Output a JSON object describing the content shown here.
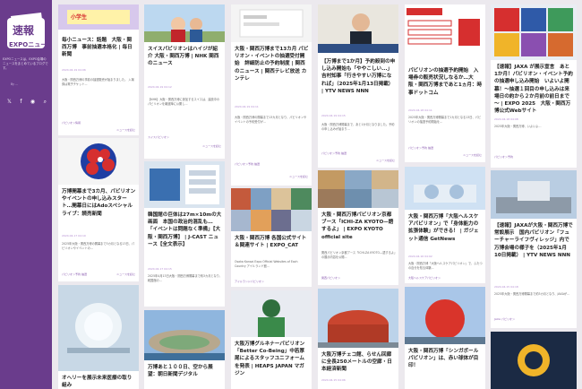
{
  "sidebar": {
    "logo_text": "EXPOニュース",
    "logo_top": "速報",
    "description": "EXPOニュースは、EXPO会場のニュースをまとめているブログです。",
    "link": "By ...",
    "icons": [
      "x-icon",
      "facebook-icon",
      "rss-icon",
      "search-icon"
    ]
  },
  "cards": [
    {
      "title": "毎小ニュース：話題　大阪・関西万博　事前抽選本格化 | 毎日新聞",
      "date": "2024.04.19 04:06",
      "excerpt": "大阪・関西万博の事前の抽選販売が始まりました。 入場券は電子チケット...",
      "tag": "パビリオン情報",
      "cm": "ニュースを読む"
    },
    {
      "title": "スイスパビリオンはハイジが紹介 大阪・関西万博 | NHK 関西のニュース",
      "date": "2024.04.19 04:12",
      "excerpt": "【NHK】大阪・関西万博に参加するスイスは、建設中のパビリオンを報道陣に公開し...",
      "tag": "スイスパビリオン",
      "cm": "ニュースを読む"
    },
    {
      "title": "大阪・関西万博まで13カ月 パビリオン・イベントの抽選受付開始　詳細防止の予約制度 | 関西のニュース | 関西テレビ放送 カンテレ",
      "date": "2024.04.19 04:11",
      "excerpt": "大阪・関西万博の開幕まで13カ月となり、パビリオンやイベントの予約受付が...",
      "tag": "パビリオン予約 抽選",
      "cm": "ニュースを読む"
    },
    {
      "title": "【万博まで1か月】予約殺到の申し込み開始も「ややこしい...」吉村知事「行きやすい万博になれば」（2025年1月13日掲載） | YTV NEWS NNN",
      "date": "2024.04.19 04:15",
      "excerpt": "大阪・関西万博開幕まで、あと1か月となりました。予約の申し込みが始まり...",
      "tag": "パビリオン予約 抽選",
      "cm": "ニュースを読む"
    },
    {
      "title": "パビリオンの抽選予約開始　入場券の販売状況しなるか…大阪・関西万博まであと1ヵ月：時事ドットコム",
      "date": "2024.04.18 04:11",
      "excerpt": "2025年大阪・関西万博開幕まで1カ月となる13日、パビリオンの抽選予約開始を...",
      "tag": "パビリオン予約 抽選",
      "cm": "ニュースを読む"
    },
    {
      "title": "【速報】JAXA が展示宣言　あと1か月！パビリオン・イベント予約の抽選申し込み開始　いよいよ開幕！～抽選１回目の申し込みは来場日の約から２か月前の前日まで～ | EXPO 2025　大阪・関西万博公式Webサイト",
      "date": "2024.04.18 04:08",
      "excerpt": "2025年大阪・関西万博、いよいよ...",
      "tag": "パビリオン予約",
      "cm": "ニュースを読む"
    },
    {
      "title": "万博開幕まで3カ月、パビリオンやイベントの申し込みスタート…開幕日にはAdoスペシャルライブ：読売新聞",
      "date": "2024.04.17 04:10",
      "excerpt": "2025年大阪・関西万博の開幕まで3カ月となる13日、パビリオンやイベントの...",
      "tag": "パビリオン予約 抽選",
      "cm": "ニュースを読む"
    },
    {
      "title": "韓国館の巨体は27m×10mの大画面　本国の政治的混乱も…「イベントは問題なく準備」【大阪・関西万博】 | J-CAST ニュース【全文表示】",
      "date": "2024.04.17 04:15",
      "excerpt": "2025年4月13日大阪・関西万博開幕まで約3カ月となり、韓国館の...",
      "tag": "韓国館",
      "cm": "ニュースを読む"
    },
    {
      "title": "大阪・関西万博 各国公式サイト＆関連サイト | EXPO_CAT",
      "date": "2024.04.16 04:06",
      "excerpt": "Osaka Kansai Expo Official Websites of Each Country アイルランド館...",
      "tag": "アイルランドパビリオン",
      "cm": "ニュースを読む"
    },
    {
      "title": "大阪・関西万博パビリオン京都ブース「ICHI-ZA KYOTO—語するよ」 | EXPO KYOTO official site",
      "date": "2024.04.16 04:21",
      "excerpt": "関西パビリオン京都ブース「ICHI-ZA KYOTO—語するよ」の展示内容を公開...",
      "tag": "関西パビリオン",
      "cm": "ニュースを読む"
    },
    {
      "title": "大阪・関西万博「大阪ヘルスケアパビリオン」で「身体能力の拡張体験」ができる！ | ガジェット通信 GetNews",
      "date": "2024.04.16 04:02",
      "excerpt": "大阪・関西万博「大阪ヘルスケアパビリオン」で、ふたつの自分を知る体験...",
      "tag": "大阪ヘルスケアパビリオン",
      "cm": "ニュースを読む"
    },
    {
      "title": "【速報】JAXAが大阪・関西万博で常設展示　国内パビリオン「フューチャーライフヴィレッジ」内で　万博会場の様子を（2025年1月10日掲載） | YTV NEWS NNN",
      "date": "2024.04.15 04:18",
      "excerpt": "2025年大阪・関西万博開幕まで約3カ月となり、JAXAが...",
      "tag": "JAXA パビリオン",
      "cm": "ニュースを読む"
    },
    {
      "title": "オヘリーを展示未来医療の取り組み",
      "date": "",
      "excerpt": "",
      "tag": "",
      "cm": ""
    },
    {
      "title": "万博あと１００日、空から展望：朝日新聞デジタル",
      "date": "",
      "excerpt": "",
      "tag": "",
      "cm": ""
    },
    {
      "title": "大阪万博グルネナーパビリオン「Better Co-Being」中若厚尾によるスタッフユニフォームを発表 | HEAPS JAPAN マガジン",
      "date": "",
      "excerpt": "",
      "tag": "",
      "cm": ""
    },
    {
      "title": "大阪万博チェコ館、らせん回廊に全長250メートルの空廊・日本経済新聞",
      "date": "2024.04.15 04:06",
      "excerpt": "",
      "tag": "",
      "cm": ""
    },
    {
      "title": "大阪・関西万博「シンガポールパビリオン」は、赤い球体が目印！",
      "date": "",
      "excerpt": "",
      "tag": "",
      "cm": ""
    },
    {
      "title": "",
      "date": "",
      "excerpt": "",
      "tag": "",
      "cm": ""
    }
  ],
  "colors": {
    "brand": "#6a3c8c",
    "accent": "#b38bd1",
    "background": "#ece9ee"
  }
}
